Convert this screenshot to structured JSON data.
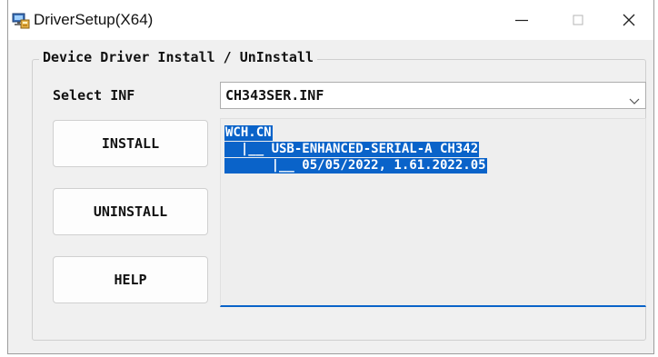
{
  "window": {
    "title": "DriverSetup(X64)",
    "icon": "driver-setup-app-icon",
    "controls": {
      "minimize": "minimize-icon",
      "maximize": "maximize-icon",
      "close": "close-icon"
    }
  },
  "group": {
    "title": "Device Driver Install / UnInstall"
  },
  "inf": {
    "label": "Select INF",
    "selected": "CH343SER.INF"
  },
  "buttons": {
    "install": "INSTALL",
    "uninstall": "UNINSTALL",
    "help": "HELP"
  },
  "tree": {
    "lines": [
      "WCH.CN",
      "  |__ USB-ENHANCED-SERIAL-A CH342",
      "      |__ 05/05/2022, 1.61.2022.05"
    ],
    "selection_color": "#0a63c9"
  }
}
